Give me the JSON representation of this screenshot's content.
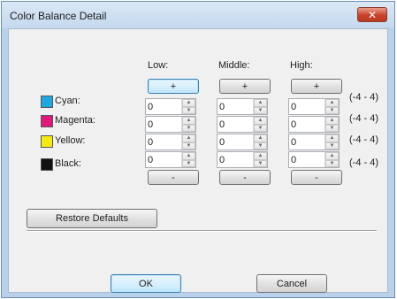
{
  "window": {
    "title": "Color Balance Detail",
    "close_glyph": "✕"
  },
  "columns": [
    {
      "header": "Low:"
    },
    {
      "header": "Middle:"
    },
    {
      "header": "High:"
    }
  ],
  "increase_label": "+",
  "decrease_label": "-",
  "spin_up_glyph": "▲",
  "spin_down_glyph": "▼",
  "rows": [
    {
      "name": "Cyan:",
      "swatch": "#1ea6e0",
      "values": [
        "0",
        "0",
        "0"
      ],
      "range": "(-4 - 4)"
    },
    {
      "name": "Magenta:",
      "swatch": "#e0187b",
      "values": [
        "0",
        "0",
        "0"
      ],
      "range": "(-4 - 4)"
    },
    {
      "name": "Yellow:",
      "swatch": "#f5ea10",
      "values": [
        "0",
        "0",
        "0"
      ],
      "range": "(-4 - 4)"
    },
    {
      "name": "Black:",
      "swatch": "#111111",
      "values": [
        "0",
        "0",
        "0"
      ],
      "range": "(-4 - 4)"
    }
  ],
  "restore_defaults": "Restore Defaults",
  "ok": "OK",
  "cancel": "Cancel"
}
